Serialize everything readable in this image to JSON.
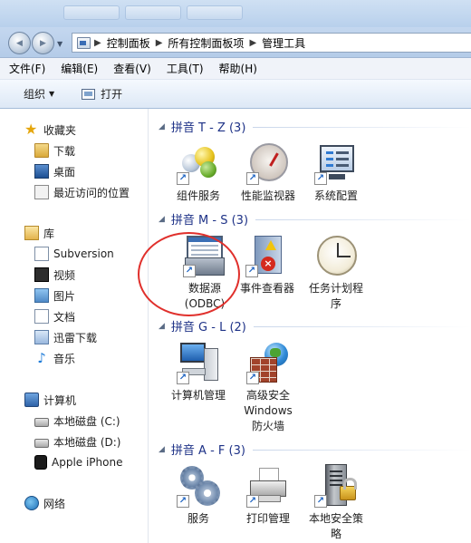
{
  "window": {
    "back_glyph": "◀",
    "forward_glyph": "▶",
    "breadcrumb": [
      "控制面板",
      "所有控制面板项",
      "管理工具"
    ],
    "breadcrumb_separator": "▶"
  },
  "menubar": [
    "文件(F)",
    "编辑(E)",
    "查看(V)",
    "工具(T)",
    "帮助(H)"
  ],
  "toolbar": {
    "organize_label": "组织",
    "organize_caret": "▼",
    "open_label": "打开"
  },
  "navpane": {
    "favorites": {
      "label": "收藏夹",
      "items": [
        "下载",
        "桌面",
        "最近访问的位置"
      ]
    },
    "libraries": {
      "label": "库",
      "items": [
        "Subversion",
        "视频",
        "图片",
        "文档",
        "迅雷下载",
        "音乐"
      ]
    },
    "computer": {
      "label": "计算机",
      "items": [
        "本地磁盘 (C:)",
        "本地磁盘 (D:)",
        "Apple iPhone"
      ]
    },
    "network": {
      "label": "网络"
    }
  },
  "groups": [
    {
      "label": "拼音 T - Z (3)",
      "items": [
        "组件服务",
        "性能监视器",
        "系统配置"
      ]
    },
    {
      "label": "拼音 M - S (3)",
      "items": [
        "数据源\n(ODBC)",
        "事件查看器",
        "任务计划程\n序"
      ]
    },
    {
      "label": "拼音 G - L (2)",
      "items": [
        "计算机管理",
        "高级安全\nWindows\n防火墙"
      ]
    },
    {
      "label": "拼音 A - F (3)",
      "items": [
        "服务",
        "打印管理",
        "本地安全策\n略"
      ]
    }
  ],
  "highlighted_item": "数据源\n(ODBC)",
  "colors": {
    "group_header": "#1e3287",
    "highlight_ring": "#e0302c"
  }
}
